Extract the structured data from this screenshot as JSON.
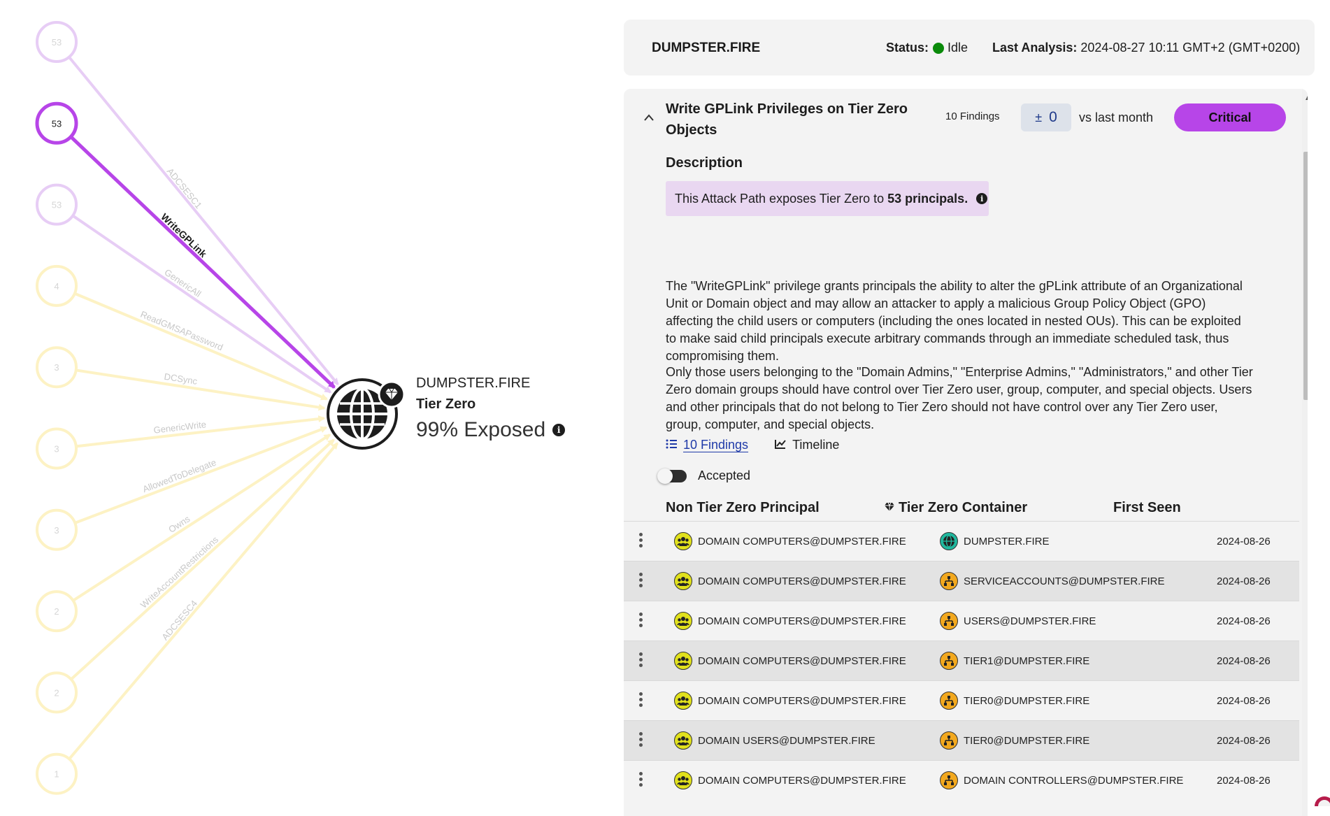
{
  "graph": {
    "target": {
      "name": "DUMPSTER.FIRE",
      "tier_label": "Tier Zero",
      "exposure": "99% Exposed"
    },
    "sources": [
      {
        "count": "53",
        "edge": "ADCSESC1",
        "highlighted": false
      },
      {
        "count": "53",
        "edge": "WriteGPLink",
        "highlighted": true
      },
      {
        "count": "53",
        "edge": "GenericAll",
        "highlighted": false
      },
      {
        "count": "4",
        "edge": "ReadGMSAPassword",
        "highlighted": false
      },
      {
        "count": "3",
        "edge": "DCSync",
        "highlighted": false
      },
      {
        "count": "3",
        "edge": "GenericWrite",
        "highlighted": false
      },
      {
        "count": "3",
        "edge": "AllowedToDelegate",
        "highlighted": false
      },
      {
        "count": "2",
        "edge": "Owns",
        "highlighted": false
      },
      {
        "count": "2",
        "edge": "WriteAccountRestrictions",
        "highlighted": false
      },
      {
        "count": "1",
        "edge": "ADCSESC4",
        "highlighted": false
      }
    ],
    "colors": {
      "highlight": "#b745e8",
      "purple_faint": "#e7cdf5",
      "yellow_faint": "#fdf2c4",
      "label_faint": "#c8c8c8"
    }
  },
  "header": {
    "domain": "DUMPSTER.FIRE",
    "status_label": "Status:",
    "status_value": "Idle",
    "status_color": "#0a8a0a",
    "last_analysis_label": "Last Analysis:",
    "last_analysis_value": "2024-08-27 10:11 GMT+2 (GMT+0200)"
  },
  "finding": {
    "title": "Write GPLink Privileges on Tier Zero Objects",
    "findings_count": "10 Findings",
    "delta_symbol": "±",
    "delta_value": "0",
    "vs_label": "vs last month",
    "severity": "Critical",
    "severity_color": "#b745e8",
    "description_heading": "Description",
    "banner_prefix": "This Attack Path exposes Tier Zero to ",
    "banner_bold": "53 principals.",
    "paragraph1": "The \"WriteGPLink\" privilege grants principals the ability to alter the gPLink attribute of an Organizational Unit or Domain object and may allow an attacker to apply a malicious Group Policy Object (GPO) affecting the child users or computers (including the ones located in nested OUs). This can be exploited to make said child principals execute arbitrary commands through an immediate scheduled task, thus compromising them.",
    "paragraph2": "Only those users belonging to the \"Domain Admins,\" \"Enterprise Admins,\" \"Administrators,\" and other Tier Zero domain groups should have control over Tier Zero user, group, computer, and special objects. Users and other principals that do not belong to Tier Zero should not have control over any Tier Zero user, group, computer, and special objects."
  },
  "tabs": {
    "findings": "10 Findings",
    "timeline": "Timeline"
  },
  "toggle": {
    "label": "Accepted"
  },
  "table": {
    "headers": {
      "principal": "Non Tier Zero Principal",
      "container": "Tier Zero Container",
      "first_seen": "First Seen"
    },
    "rows": [
      {
        "principal": "DOMAIN COMPUTERS@DUMPSTER.FIRE",
        "container": "DUMPSTER.FIRE",
        "container_icon": "domain-icon",
        "first_seen": "2024-08-26"
      },
      {
        "principal": "DOMAIN COMPUTERS@DUMPSTER.FIRE",
        "container": "SERVICEACCOUNTS@DUMPSTER.FIRE",
        "container_icon": "ou-icon",
        "first_seen": "2024-08-26"
      },
      {
        "principal": "DOMAIN COMPUTERS@DUMPSTER.FIRE",
        "container": "USERS@DUMPSTER.FIRE",
        "container_icon": "ou-icon",
        "first_seen": "2024-08-26"
      },
      {
        "principal": "DOMAIN COMPUTERS@DUMPSTER.FIRE",
        "container": "TIER1@DUMPSTER.FIRE",
        "container_icon": "ou-icon",
        "first_seen": "2024-08-26"
      },
      {
        "principal": "DOMAIN COMPUTERS@DUMPSTER.FIRE",
        "container": "TIER0@DUMPSTER.FIRE",
        "container_icon": "ou-icon",
        "first_seen": "2024-08-26"
      },
      {
        "principal": "DOMAIN USERS@DUMPSTER.FIRE",
        "container": "TIER0@DUMPSTER.FIRE",
        "container_icon": "ou-icon",
        "first_seen": "2024-08-26"
      },
      {
        "principal": "DOMAIN COMPUTERS@DUMPSTER.FIRE",
        "container": "DOMAIN CONTROLLERS@DUMPSTER.FIRE",
        "container_icon": "ou-icon",
        "first_seen": "2024-08-26"
      }
    ]
  }
}
